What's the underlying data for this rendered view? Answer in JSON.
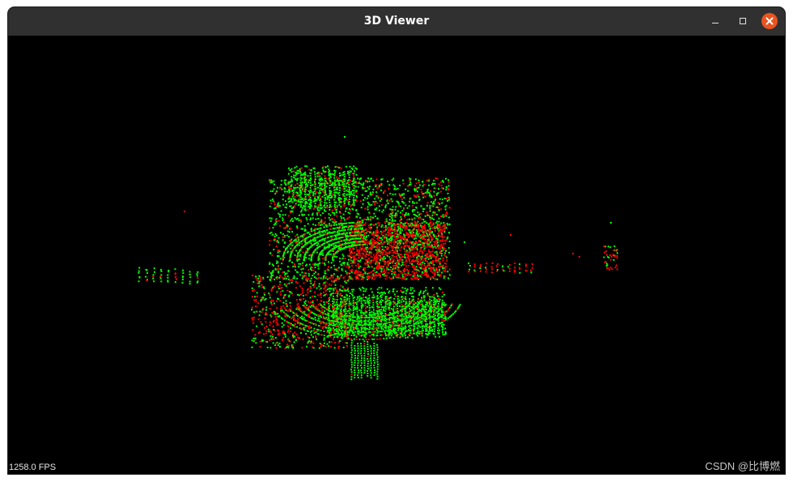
{
  "window": {
    "title": "3D Viewer",
    "buttons": {
      "minimize_icon": "minimize-icon",
      "maximize_icon": "maximize-icon",
      "close_icon": "close-icon"
    }
  },
  "viewer": {
    "background": "#000000",
    "fps_label": "1258.0 FPS",
    "point_colors": {
      "green": "#00ff00",
      "red": "#ff0000"
    }
  },
  "watermark": "CSDN @比博燃"
}
